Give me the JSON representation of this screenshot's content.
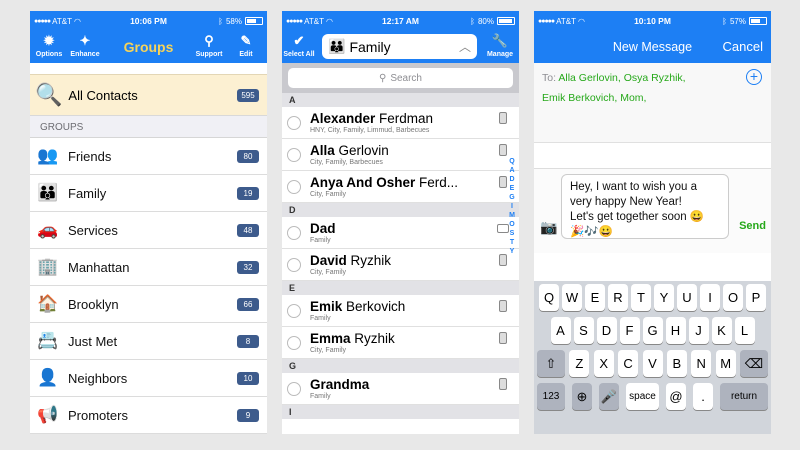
{
  "status": [
    {
      "carrier": "AT&T",
      "time": "10:06 PM",
      "battery": "58%",
      "battery_level": 0.58
    },
    {
      "carrier": "AT&T",
      "time": "12:17 AM",
      "battery": "80%",
      "battery_level": 0.8
    },
    {
      "carrier": "AT&T",
      "time": "10:10 PM",
      "battery": "57%",
      "battery_level": 0.57
    }
  ],
  "groups_screen": {
    "title": "Groups",
    "options_label": "Options",
    "enhance_label": "Enhance",
    "support_label": "Support",
    "edit_label": "Edit",
    "all_contacts": {
      "label": "All Contacts",
      "count": "595"
    },
    "section_header": "GROUPS",
    "groups": [
      {
        "label": "Friends",
        "count": "80",
        "icon": "friends-icon"
      },
      {
        "label": "Family",
        "count": "19",
        "icon": "family-icon"
      },
      {
        "label": "Services",
        "count": "48",
        "icon": "car-icon"
      },
      {
        "label": "Manhattan",
        "count": "32",
        "icon": "building-icon"
      },
      {
        "label": "Brooklyn",
        "count": "66",
        "icon": "house-icon"
      },
      {
        "label": "Just Met",
        "count": "8",
        "icon": "card-icon"
      },
      {
        "label": "Neighbors",
        "count": "10",
        "icon": "person-icon"
      },
      {
        "label": "Promoters",
        "count": "9",
        "icon": "megaphone-icon"
      }
    ]
  },
  "family_screen": {
    "select_all_label": "Select All",
    "manage_label": "Manage",
    "group_name": "Family",
    "search_placeholder": "Search",
    "letters": {
      "A": "A",
      "D": "D",
      "E": "E",
      "G": "G",
      "I": "I"
    },
    "contacts": [
      {
        "first": "Alexander",
        "last": "Ferdman",
        "sub": "HNY, City, Family, Limmud, Barbecues"
      },
      {
        "first": "Alla",
        "last": "Gerlovin",
        "sub": "City, Family, Barbecues"
      },
      {
        "first": "Anya And Osher",
        "last": "Ferd...",
        "sub": "City, Family"
      },
      {
        "first": "Dad",
        "last": "",
        "sub": "Family"
      },
      {
        "first": "David",
        "last": "Ryzhik",
        "sub": "City, Family"
      },
      {
        "first": "Emik",
        "last": "Berkovich",
        "sub": "Family"
      },
      {
        "first": "Emma",
        "last": "Ryzhik",
        "sub": "City, Family"
      },
      {
        "first": "Grandma",
        "last": "",
        "sub": "Family"
      }
    ],
    "index_letters": [
      "Q",
      "A",
      "D",
      "E",
      "G",
      "I",
      "M",
      "O",
      "S",
      "T",
      "Y"
    ]
  },
  "message_screen": {
    "title": "New Message",
    "cancel_label": "Cancel",
    "to_label": "To:",
    "recipients": [
      "Alla Gerlovin,",
      "Osya Ryzhik,",
      "Emik Berkovich,",
      "Mom,"
    ],
    "message_lines": [
      "Hey, I want to wish you a",
      "very happy New Year!",
      "Let's get together soon 😀",
      "🎉🎶😀"
    ],
    "send_label": "Send",
    "keys": {
      "row1": [
        "Q",
        "W",
        "E",
        "R",
        "T",
        "Y",
        "U",
        "I",
        "O",
        "P"
      ],
      "row2": [
        "A",
        "S",
        "D",
        "F",
        "G",
        "H",
        "J",
        "K",
        "L"
      ],
      "row3": [
        "Z",
        "X",
        "C",
        "V",
        "B",
        "N",
        "M"
      ],
      "num": "123",
      "space": "space",
      "at": "@",
      "dot": ".",
      "return": "return"
    }
  }
}
